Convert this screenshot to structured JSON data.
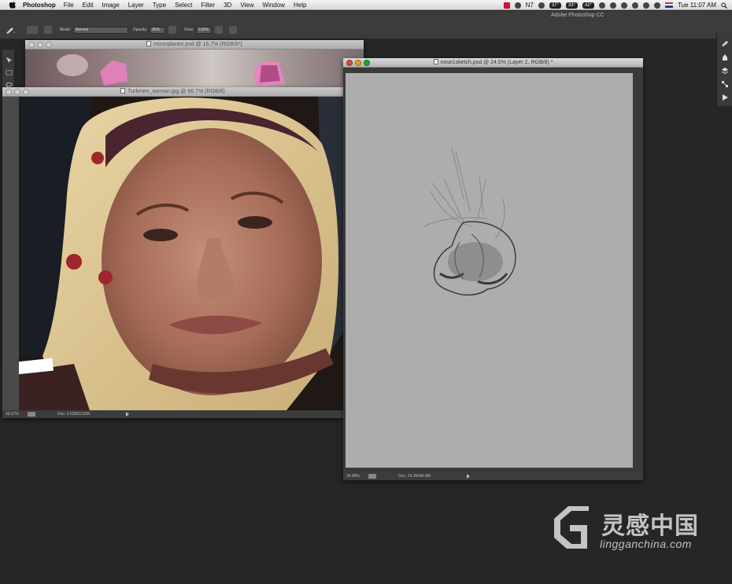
{
  "menubar": {
    "app_name": "Photoshop",
    "items": [
      "File",
      "Edit",
      "Image",
      "Layer",
      "Type",
      "Select",
      "Filter",
      "3D",
      "View",
      "Window",
      "Help"
    ],
    "status": {
      "count": "7",
      "temp1": "37°",
      "temp2": "33°",
      "temp3": "42°",
      "clock": "Tue 11:07 AM"
    }
  },
  "options_bar": {
    "app_title": "Adobe Photoshop CC",
    "mode_label": "Mode:",
    "mode_value": "Normal",
    "opacity_label": "Opacity:",
    "opacity_value": "86%",
    "flow_label": "Flow:",
    "flow_value": "100%"
  },
  "windows": {
    "minorplanes": {
      "title": "minorplanes.psd @ 16.7% (RGB/8*)"
    },
    "turkmen": {
      "title": "Turkmen_woman.jpg @ 66.7% (RGB/8)",
      "zoom": "66.67%",
      "doc_info": "Doc: 3.52M/3.52M"
    },
    "nose": {
      "title": "nose1sketch.psd @ 24.5% (Layer 2, RGB/8) *",
      "zoom": "24.48%",
      "doc_info": "Doc: 24.1M/46.0M"
    }
  },
  "watermark": {
    "cn": "灵感中国",
    "en": "lingganchina.com"
  }
}
